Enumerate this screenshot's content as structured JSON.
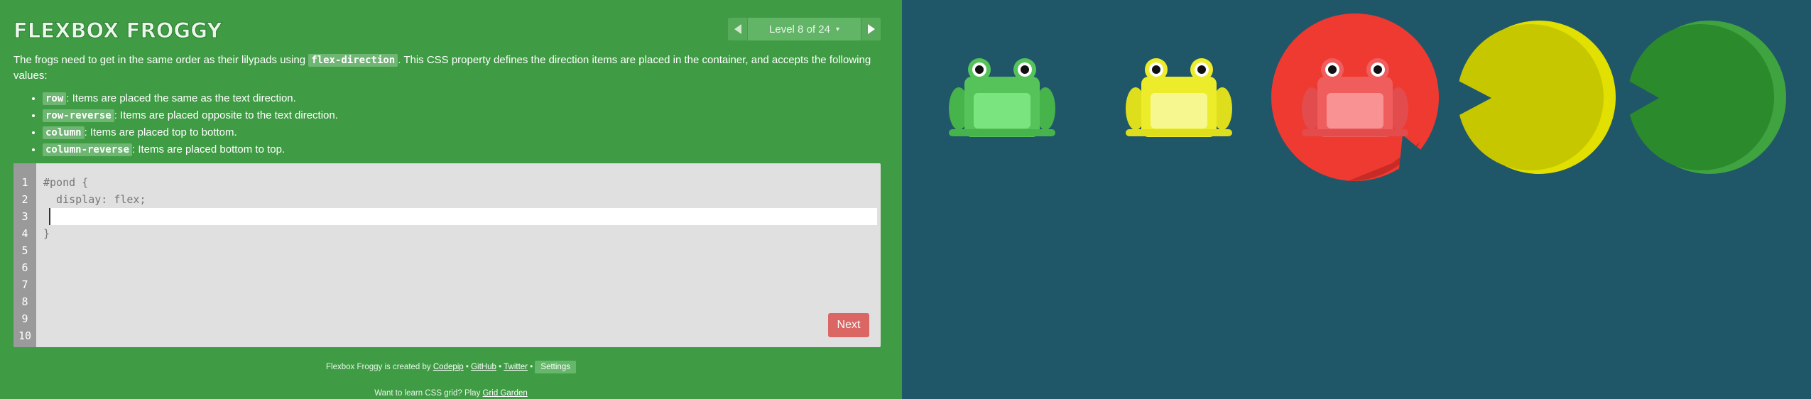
{
  "app": {
    "title": "FLEXBOX FROGGY"
  },
  "level_nav": {
    "label": "Level 8 of 24",
    "caret": "▾"
  },
  "instructions": {
    "intro_before": "The frogs need to get in the same order as their lilypads using ",
    "intro_code": "flex-direction",
    "intro_after": ". This CSS property defines the direction items are placed in the container, and accepts the following values:",
    "options": [
      {
        "code": "row",
        "text": ": Items are placed the same as the text direction."
      },
      {
        "code": "row-reverse",
        "text": ": Items are placed opposite to the text direction."
      },
      {
        "code": "column",
        "text": ": Items are placed top to bottom."
      },
      {
        "code": "column-reverse",
        "text": ": Items are placed bottom to top."
      }
    ]
  },
  "editor": {
    "line_numbers": [
      "1",
      "2",
      "3",
      "4",
      "5",
      "6",
      "7",
      "8",
      "9",
      "10"
    ],
    "line1": "#pond {",
    "line2": "  display: flex;",
    "input_value": "",
    "line4": "}",
    "next_label": "Next"
  },
  "footer": {
    "credit_prefix": "Flexbox Froggy is created by ",
    "codepip": "Codepip",
    "sep": " • ",
    "github": "GitHub",
    "twitter": "Twitter",
    "settings": "Settings",
    "promo_prefix": "Want to learn CSS grid? Play ",
    "grid_garden": "Grid Garden"
  },
  "pond": {
    "background": "#1f5768",
    "frogs": [
      {
        "color": "green",
        "body": "#56c35a",
        "belly": "#7ae57e"
      },
      {
        "color": "yellow",
        "body": "#ecec2a",
        "belly": "#f7f78f"
      },
      {
        "color": "red",
        "body": "#ef5d5d",
        "belly": "#f99292"
      }
    ],
    "lilypads": [
      {
        "color": "red",
        "fill": "#ee3a31",
        "shade": "#c72b25"
      },
      {
        "color": "yellow",
        "fill": "#c7c700",
        "shade": "#e2e000"
      },
      {
        "color": "green",
        "fill": "#2b8a2b",
        "shade": "#3fa33f"
      }
    ]
  }
}
